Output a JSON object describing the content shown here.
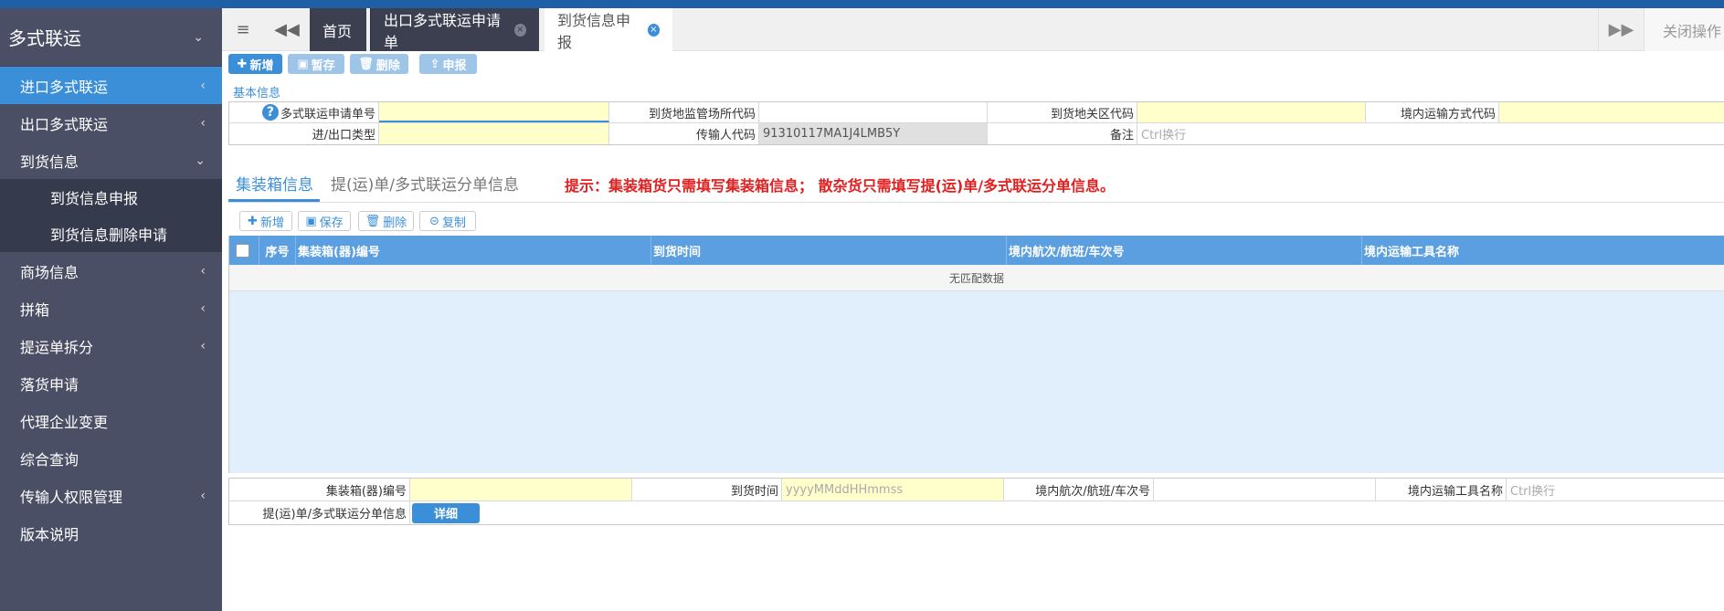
{
  "sidebar": {
    "title": "多式联运",
    "items": [
      {
        "label": "进口多式联运",
        "chevron": "‹",
        "active": true
      },
      {
        "label": "出口多式联运",
        "chevron": "‹"
      },
      {
        "label": "到货信息",
        "chevron": "⌄"
      },
      {
        "label": "到货信息申报",
        "sub": true
      },
      {
        "label": "到货信息删除申请",
        "sub": true
      },
      {
        "label": "商场信息",
        "chevron": "‹"
      },
      {
        "label": "拼箱",
        "chevron": "‹"
      },
      {
        "label": "提运单拆分",
        "chevron": "‹"
      },
      {
        "label": "落货申请"
      },
      {
        "label": "代理企业变更"
      },
      {
        "label": "综合查询"
      },
      {
        "label": "传输人权限管理",
        "chevron": "‹"
      },
      {
        "label": "版本说明"
      }
    ]
  },
  "tabs": {
    "home": "首页",
    "tab1": "出口多式联运申请单",
    "tab2": "到货信息申报",
    "close_ops": "关闭操作"
  },
  "toolbar": {
    "add": "新增",
    "save_draft": "暂存",
    "delete": "删除",
    "submit": "申报"
  },
  "basic_info": {
    "title": "基本信息",
    "fields": {
      "app_no_label": "多式联运申请单号",
      "app_no_value": "",
      "customs_place_label": "到货地监管场所代码",
      "customs_place_value": "",
      "customs_area_label": "到货地关区代码",
      "customs_area_value": "",
      "transport_mode_label": "境内运输方式代码",
      "transport_mode_value": "",
      "io_type_label": "进/出口类型",
      "io_type_value": "",
      "transmitter_label": "传输人代码",
      "transmitter_value": "91310117MA1J4LMB5Y",
      "remark_label": "备注",
      "remark_placeholder": "Ctrl换行"
    }
  },
  "content_tabs": {
    "container": "集装箱信息",
    "bill": "提(运)单/多式联运分单信息",
    "hint": "提示：集装箱货只需填写集装箱信息； 散杂货只需填写提(运)单/多式联运分单信息。"
  },
  "grid_toolbar": {
    "add": "新增",
    "save": "保存",
    "delete": "删除",
    "copy": "复制"
  },
  "grid": {
    "columns": [
      "序号",
      "集装箱(器)编号",
      "到货时间",
      "境内航次/航班/车次号",
      "境内运输工具名称"
    ],
    "empty_text": "无匹配数据"
  },
  "bottom_form": {
    "container_no_label": "集装箱(器)编号",
    "container_no_value": "",
    "arrival_time_label": "到货时间",
    "arrival_time_placeholder": "yyyyMMddHHmmss",
    "voyage_label": "境内航次/航班/车次号",
    "voyage_value": "",
    "vehicle_label": "境内运输工具名称",
    "vehicle_placeholder": "Ctrl换行",
    "bill_label": "提(运)单/多式联运分单信息",
    "detail_button": "详细"
  }
}
